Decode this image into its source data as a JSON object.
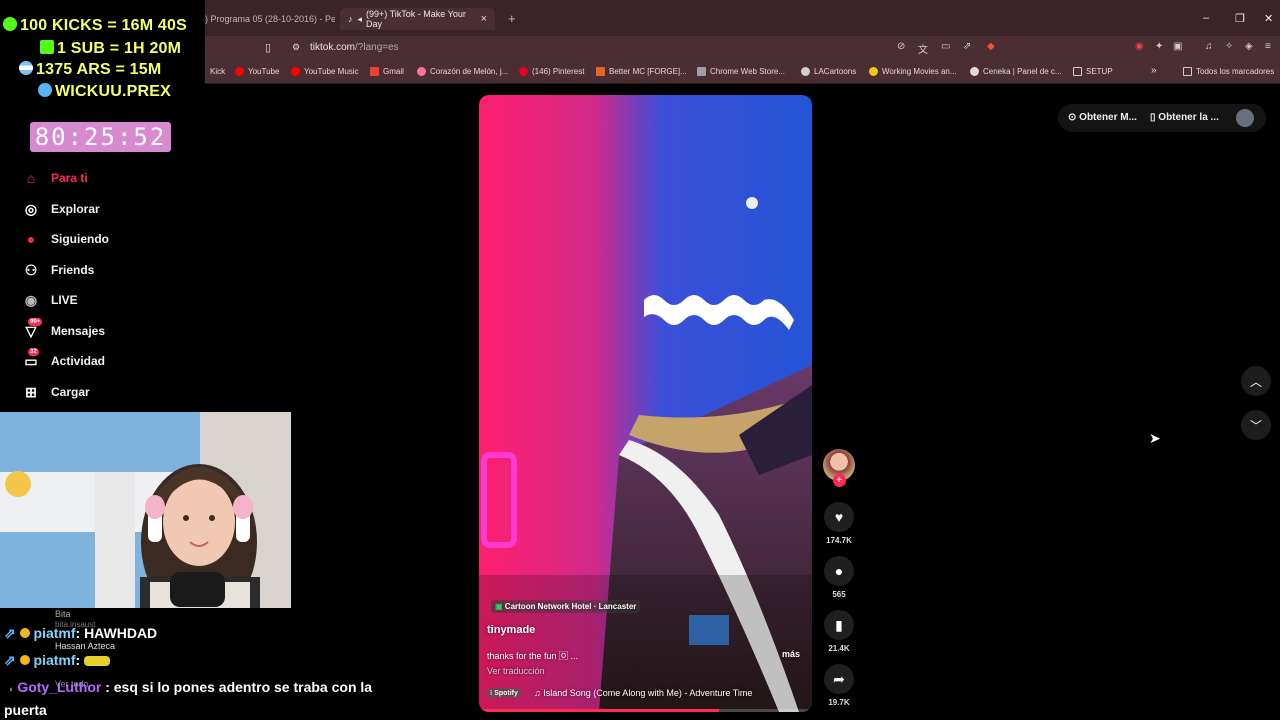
{
  "overlay": {
    "line1": "100 KICKS = 16M 40S",
    "line2": "1 SUB = 1H 20M",
    "line3": "1375 ARS = 15M",
    "line4": "WICKUU.PREX",
    "timer": "80:25:52"
  },
  "browser": {
    "tabs": [
      {
        "label": ") Programa 05 (28-10-2016) - Pe"
      },
      {
        "label": "(99+) TikTok - Make Your Day"
      }
    ],
    "url_host": "tiktok.com",
    "url_path": "/?lang=es",
    "bookmarks": [
      {
        "label": "Kick",
        "color": "#53fc18"
      },
      {
        "label": "YouTube",
        "color": "#ff0000"
      },
      {
        "label": "YouTube Music",
        "color": "#ff0000"
      },
      {
        "label": "Gmail",
        "color": "#ea4335"
      },
      {
        "label": "Corazón de Melón, j...",
        "color": "#ff6fa3"
      },
      {
        "label": "(146) Pinterest",
        "color": "#e60023"
      },
      {
        "label": "Better MC [FORGE]...",
        "color": "#e7632c"
      },
      {
        "label": "Chrome Web Store...",
        "color": "#9aa0a6"
      },
      {
        "label": "LACartoons",
        "color": "#cfcfcf"
      },
      {
        "label": "Working Movies an...",
        "color": "#f5c518"
      },
      {
        "label": "Ceneka | Panel de c...",
        "color": "#dddddd"
      },
      {
        "label": "SETUP",
        "color": "#cfcfcf"
      },
      {
        "label": "Todos los marcadores",
        "color": "#cfcfcf"
      }
    ]
  },
  "sidebar": {
    "items": [
      {
        "label": "Para ti",
        "icon": "home-icon",
        "glyph": "⌂"
      },
      {
        "label": "Explorar",
        "icon": "compass-icon",
        "glyph": "◎"
      },
      {
        "label": "Siguiendo",
        "icon": "following-avatar-icon",
        "glyph": "●"
      },
      {
        "label": "Friends",
        "icon": "friends-icon",
        "glyph": "⚇"
      },
      {
        "label": "LIVE",
        "icon": "live-icon",
        "glyph": "◉"
      },
      {
        "label": "Mensajes",
        "icon": "messages-icon",
        "glyph": "▽",
        "badge": "99+"
      },
      {
        "label": "Actividad",
        "icon": "activity-icon",
        "glyph": "▭",
        "badge": "32"
      },
      {
        "label": "Cargar",
        "icon": "upload-icon",
        "glyph": "⊞"
      }
    ]
  },
  "chat": {
    "msg1_user": "piatmf",
    "msg1_text": ": HAWHDAD",
    "faded1": "Bita",
    "faded2": "bita.insaust",
    "faded3": "Hassan Azteca",
    "msg2_user": "piatmf",
    "msg2_text": ":",
    "msg3_user": "Goty_Luthor",
    "msg3_text": ": esq si lo pones adentro se traba con la",
    "msg3_text2": "puerta",
    "faded4": "Ver todo",
    "colors": {
      "piatmf": "#7fd4ff",
      "goty": "#b46bff"
    }
  },
  "video": {
    "location": "Cartoon Network Hotel · Lancaster",
    "author": "tinymade",
    "caption": "thanks for the fun 🄾 ...",
    "more": "más",
    "translate": "Ver traducción",
    "music_source": "Spotify",
    "music": "Island Song (Come Along with Me) - Adventure Time",
    "progress": 0.72
  },
  "actions": {
    "likes": "174.7K",
    "comments": "565",
    "saves": "21.4K",
    "shares": "19.7K"
  },
  "top_right": {
    "btn1": "Obtener M...",
    "btn2": "Obtener la ..."
  }
}
